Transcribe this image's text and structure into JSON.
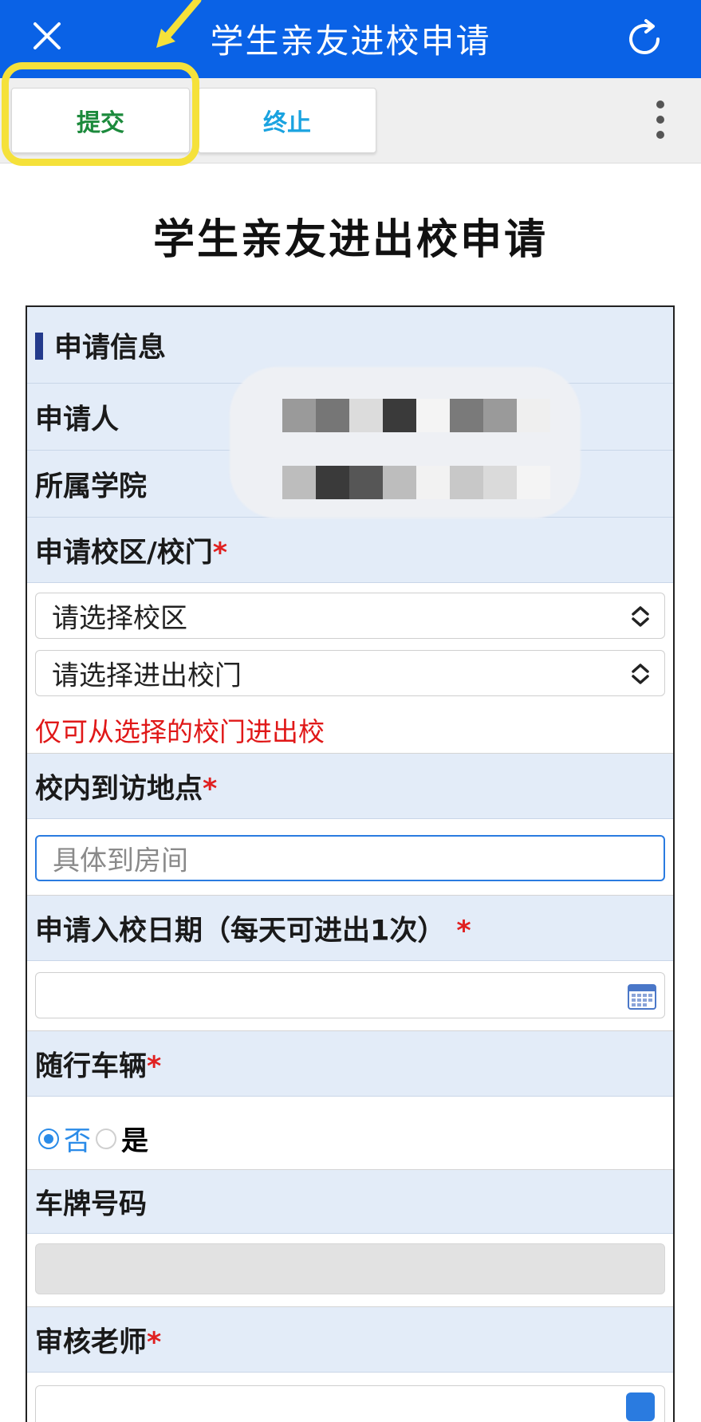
{
  "header": {
    "title": "学生亲友进校申请",
    "close_icon": "close-icon",
    "refresh_icon": "refresh-icon",
    "bg_color": "#0a62e6"
  },
  "toolbar": {
    "submit_label": "提交",
    "stop_label": "终止",
    "more_icon": "more-vertical-icon",
    "highlight_color": "#f5e13a"
  },
  "page": {
    "title": "学生亲友进出校申请"
  },
  "form": {
    "section_title": "申请信息",
    "applicant_label": "申请人",
    "college_label": "所属学院",
    "campus_gate_label": "申请校区/校门",
    "campus_select_placeholder": "请选择校区",
    "gate_select_placeholder": "请选择进出校门",
    "gate_note": "仅可从选择的校门进出校",
    "visit_location_label": "校内到访地点",
    "visit_location_placeholder": "具体到房间",
    "entry_date_label": "申请入校日期（每天可进出1次）",
    "entry_date_value": "",
    "vehicle_label": "随行车辆",
    "vehicle_options": [
      "否",
      "是"
    ],
    "vehicle_selected": "否",
    "plate_label": "车牌号码",
    "plate_value": "",
    "reviewer_label": "审核老师",
    "required_mark": "*",
    "required_color": "#e02020"
  }
}
